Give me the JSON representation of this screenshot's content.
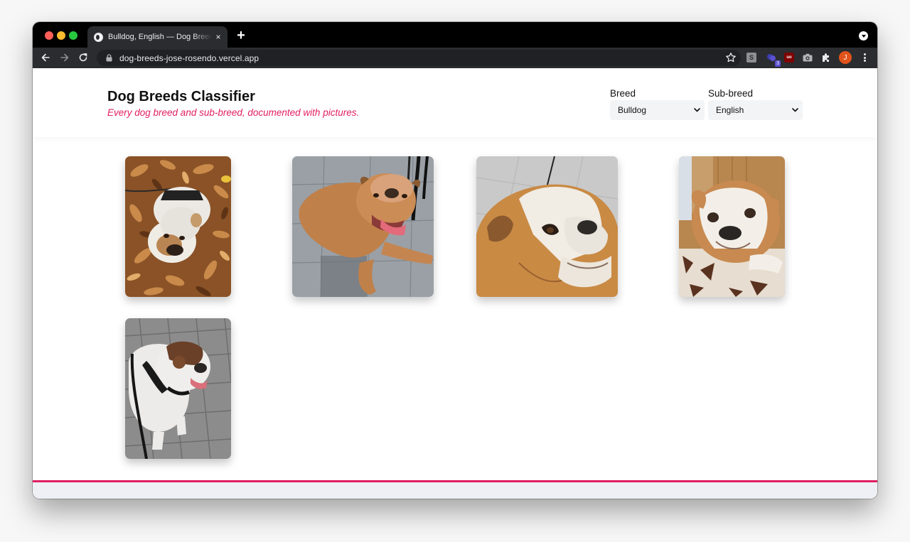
{
  "browser": {
    "tab_title": "Bulldog, English — Dog Breeds Classifier",
    "new_tab_symbol": "+",
    "close_symbol": "×",
    "url": "dog-breeds-jose-rosendo.vercel.app",
    "extension_badge": "3",
    "ext_s_label": "S",
    "ext_ub_label": "uo",
    "profile_initial": "J"
  },
  "header": {
    "title": "Dog Breeds Classifier",
    "subtitle": "Every dog breed and sub-breed, documented with pictures."
  },
  "filters": {
    "breed_label": "Breed",
    "breed_value": "Bulldog",
    "subbreed_label": "Sub-breed",
    "subbreed_value": "English"
  },
  "colors": {
    "accent": "#e11d63",
    "tab_bg": "#2b2c2f",
    "strip_bg": "#000000",
    "select_bg": "#f3f4f6"
  },
  "images": [
    {
      "name": "bulldog-photo-1",
      "scene": "white bulldog lying in autumn leaves"
    },
    {
      "name": "bulldog-photo-2",
      "scene": "tan bulldog lying on stone tiles with tongue out"
    },
    {
      "name": "bulldog-photo-3",
      "scene": "close-up of tan and white bulldog face"
    },
    {
      "name": "bulldog-photo-4",
      "scene": "white and tan bulldog on a patterned rug"
    },
    {
      "name": "bulldog-photo-5",
      "scene": "white and brindle bulldog with harness on paving"
    }
  ]
}
